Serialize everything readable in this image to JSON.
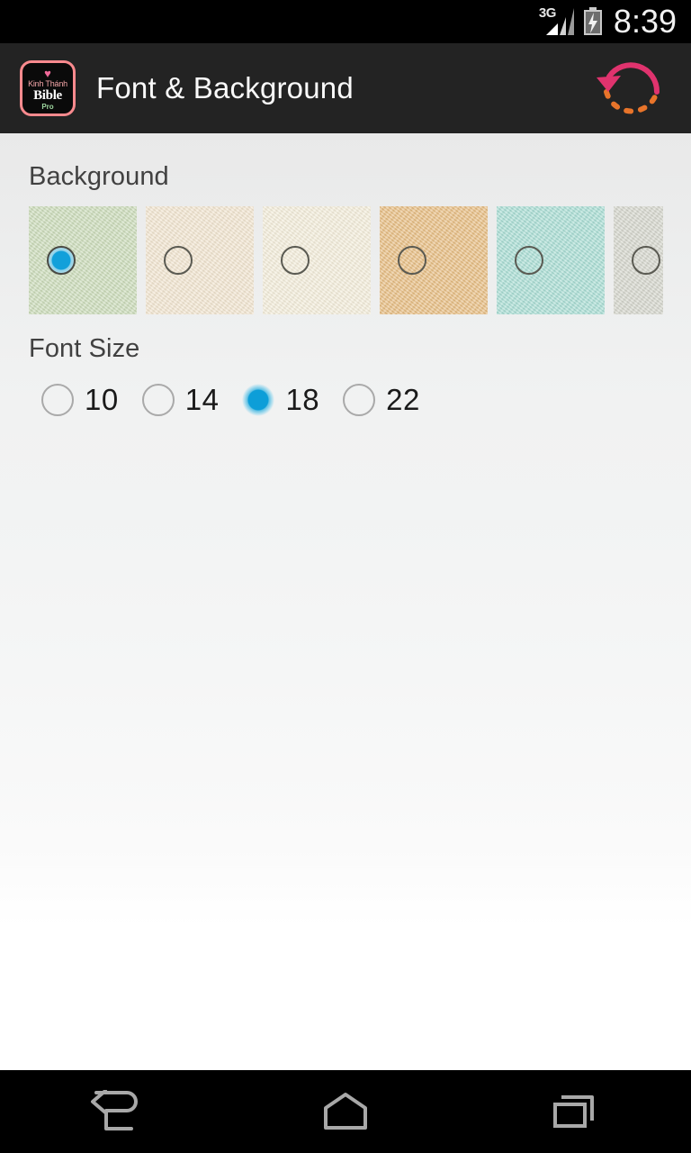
{
  "status_bar": {
    "network_label": "3G",
    "signal_icon": "signal-bars-icon",
    "battery_icon": "battery-charging-icon",
    "time": "8:39"
  },
  "action_bar": {
    "app_icon": {
      "name": "app-logo-icon",
      "heart": "♥",
      "line1": "Kinh Thánh",
      "line2": "Bible",
      "line3": "Pro",
      "border_color": "#f98a8e",
      "bg_color": "#0a0a0a"
    },
    "title": "Font & Background",
    "refresh_icon": "refresh-reset-icon",
    "bar_color": "#232323",
    "title_color": "#fafafa"
  },
  "background_section": {
    "label": "Background",
    "selected_index": 0,
    "swatches": [
      {
        "name": "swatch-green",
        "color": "#cbdcb9",
        "selected": true,
        "partial": false
      },
      {
        "name": "swatch-beige",
        "color": "#f3e6d0",
        "selected": false,
        "partial": false
      },
      {
        "name": "swatch-cream",
        "color": "#f5eedb",
        "selected": false,
        "partial": false
      },
      {
        "name": "swatch-tan",
        "color": "#e8bd80",
        "selected": false,
        "partial": false
      },
      {
        "name": "swatch-teal",
        "color": "#a8ded4",
        "selected": false,
        "partial": false
      },
      {
        "name": "swatch-gray",
        "color": "#d5d6cc",
        "selected": false,
        "partial": true
      }
    ]
  },
  "font_size_section": {
    "label": "Font Size",
    "selected_value": "18",
    "options": [
      {
        "label": "10",
        "selected": false
      },
      {
        "label": "14",
        "selected": false
      },
      {
        "label": "18",
        "selected": true
      },
      {
        "label": "22",
        "selected": false
      }
    ]
  },
  "nav_bar": {
    "back_icon": "back-arrow-icon",
    "home_icon": "home-icon",
    "recents_icon": "recent-apps-icon"
  },
  "theme": {
    "accent_blue": "#0d9ed8",
    "content_bg_top": "#e9e9e9",
    "content_bg_bottom": "#ffffff",
    "nav_bg": "#000000",
    "status_bg": "#000000"
  }
}
